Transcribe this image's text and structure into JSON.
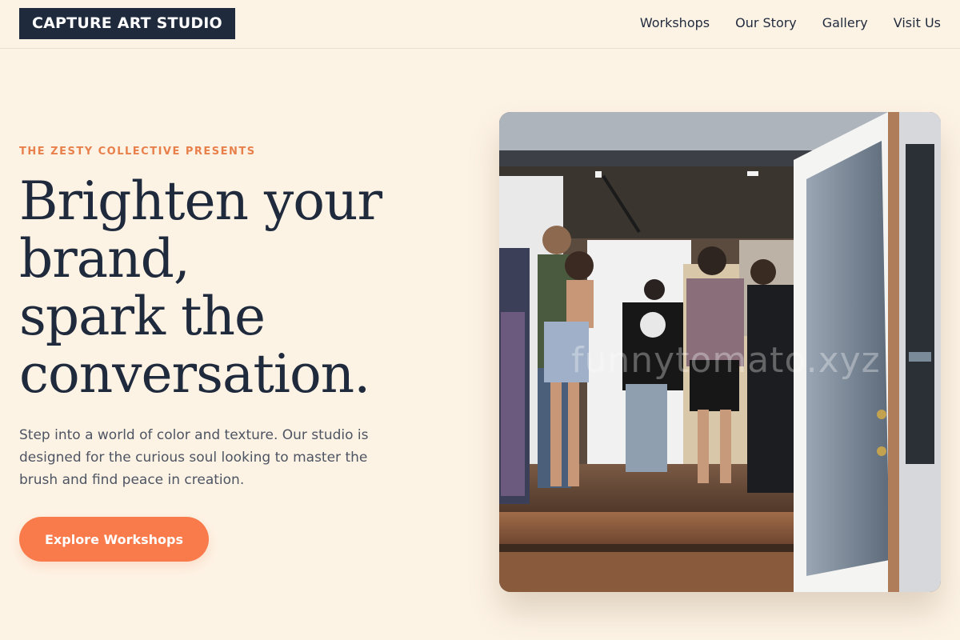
{
  "header": {
    "brand": "CAPTURE ART STUDIO",
    "nav": [
      "Workshops",
      "Our Story",
      "Gallery",
      "Visit Us"
    ]
  },
  "hero": {
    "eyebrow": "THE ZESTY COLLECTIVE PRESENTS",
    "headline_lines": [
      "Brighten your",
      "brand,",
      "spark the",
      "conversation."
    ],
    "lede": "Step into a world of color and texture. Our studio is designed for the curious soul looking to master the brush and find peace in creation.",
    "cta_label": "Explore Workshops"
  },
  "photo": {
    "watermark": "funnytomato.xyz"
  },
  "colors": {
    "background": "#fdf3e5",
    "ink": "#1f2a3d",
    "accent": "#f97a4b",
    "eyebrow": "#e8804c"
  }
}
